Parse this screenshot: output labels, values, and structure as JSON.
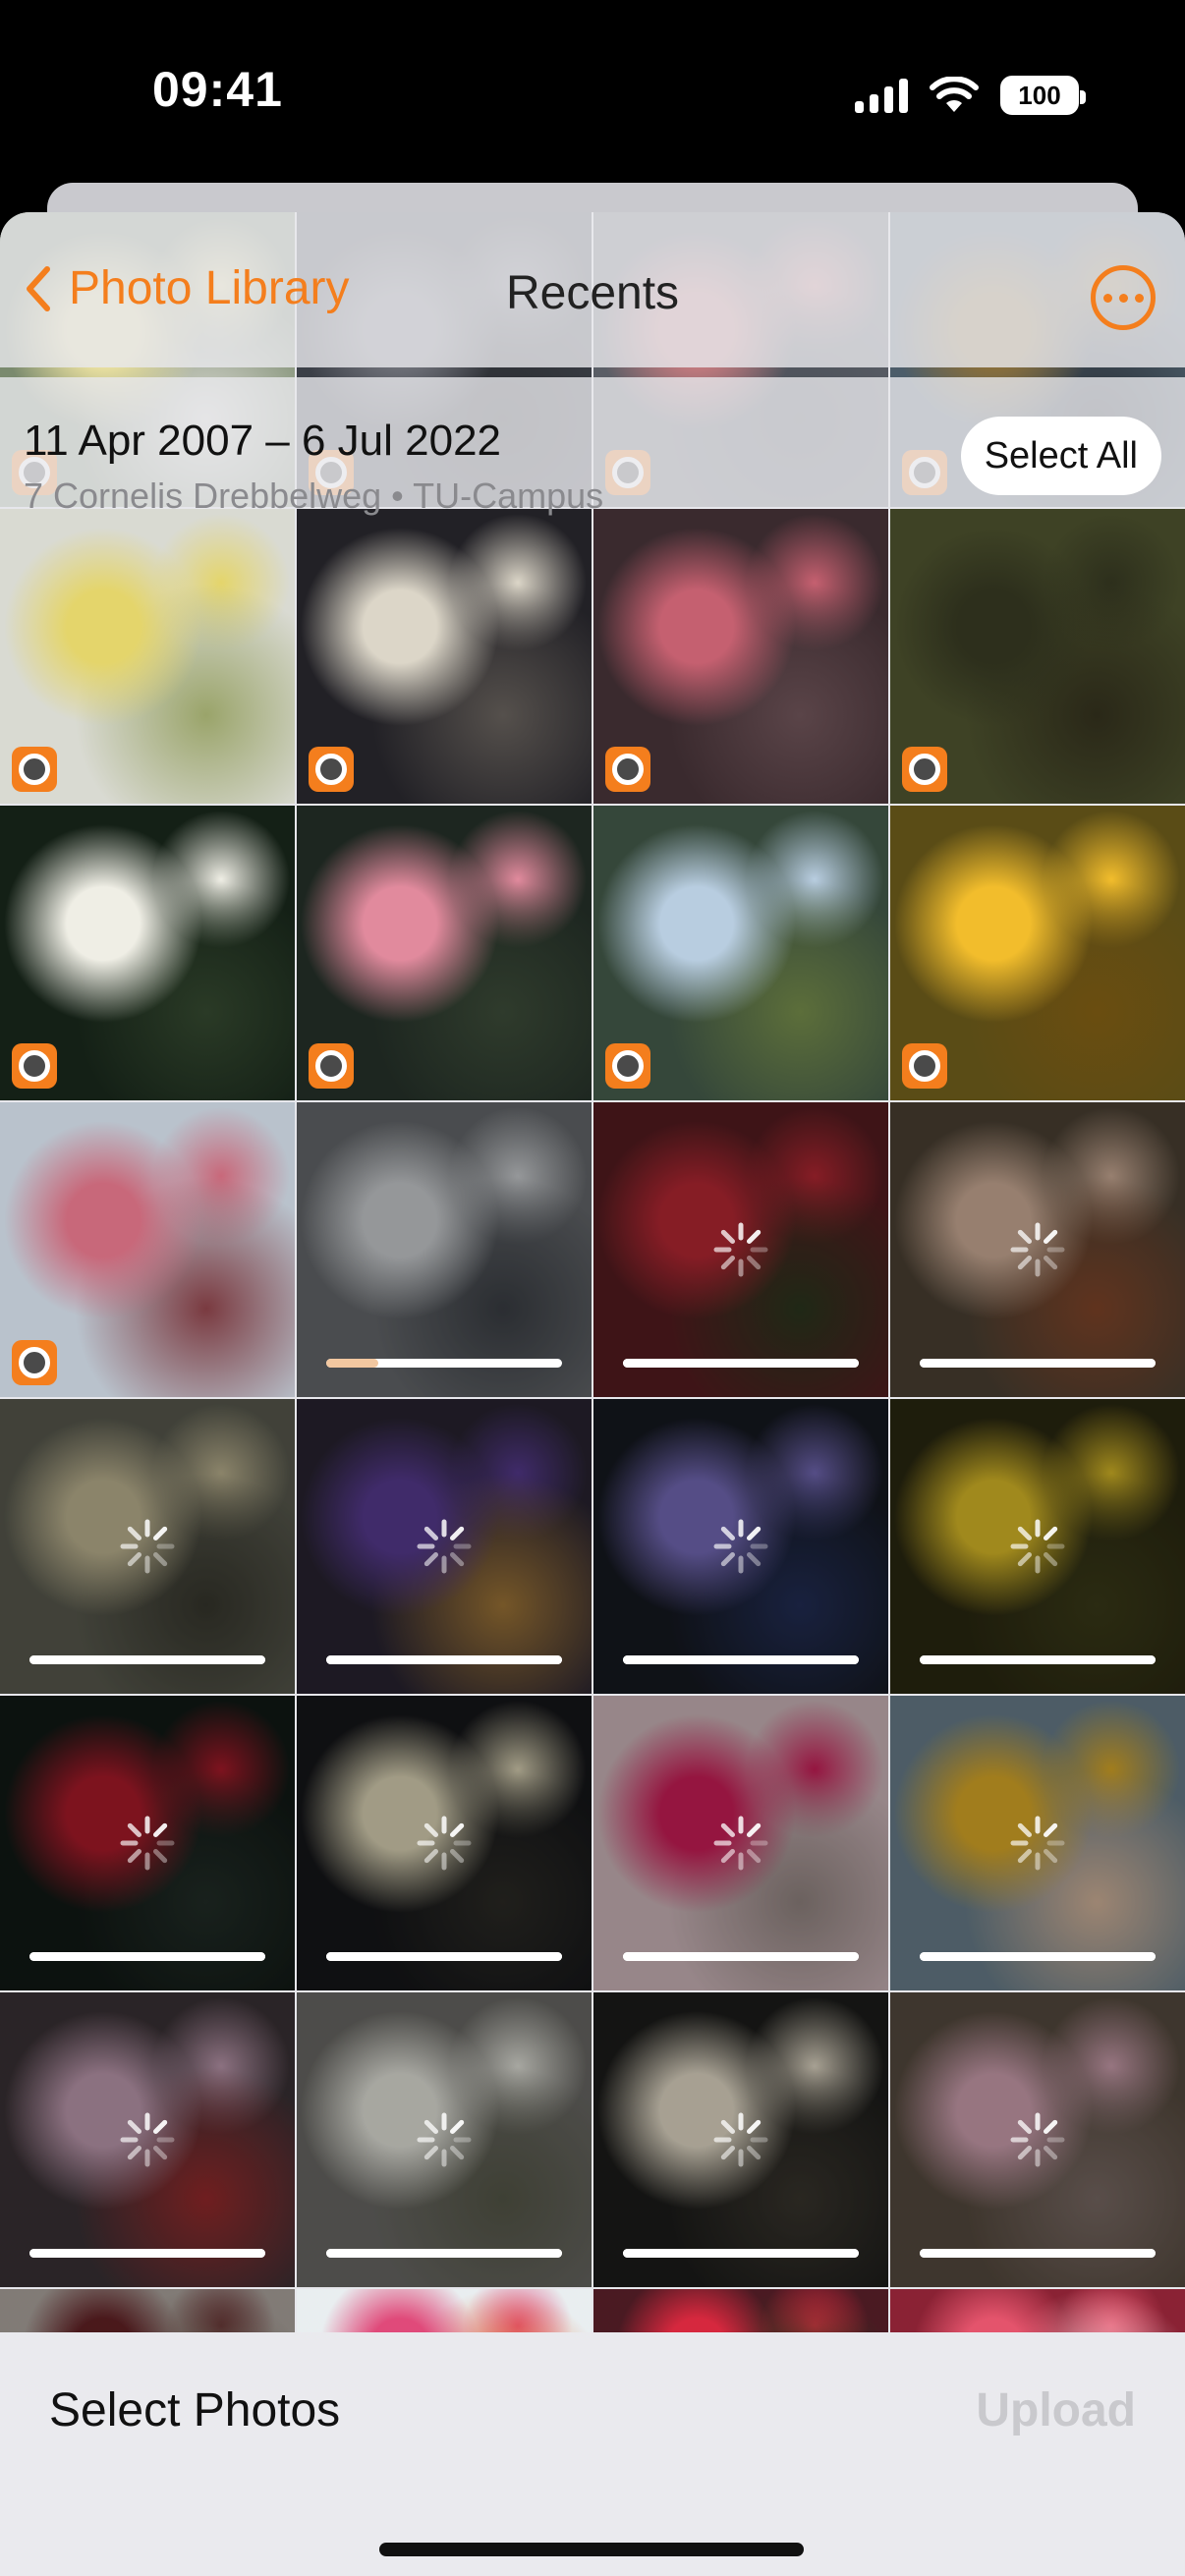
{
  "status_bar": {
    "time": "09:41",
    "battery": "100"
  },
  "nav": {
    "back_label": "Photo Library",
    "title": "Recents",
    "more_icon": "ellipsis-circle-icon"
  },
  "header": {
    "date_range": "11 Apr 2007 – 6 Jul 2022",
    "location": "7 Cornelis Drebbelweg • TU-Campus",
    "select_all": "Select All"
  },
  "toolbar": {
    "select_photos": "Select Photos",
    "upload": "Upload"
  },
  "colors": {
    "accent": "#f47e1d",
    "upload_disabled": "#c9c9cd"
  },
  "photos": [
    {
      "state": "badge",
      "bg": "#7a8a6e",
      "c1": "#e9e0a0",
      "c2": "#d7d7d0"
    },
    {
      "state": "badge",
      "bg": "#3b3f47",
      "c1": "#6e7078",
      "c2": "#2a2c30"
    },
    {
      "state": "badge",
      "bg": "#5a5e66",
      "c1": "#c27a7e",
      "c2": "#4a4f58"
    },
    {
      "state": "badge",
      "bg": "#4c5d6a",
      "c1": "#8a6f3a",
      "c2": "#2a3038"
    },
    {
      "state": "badge",
      "bg": "#d9dad2",
      "c1": "#e4d56b",
      "c2": "#9aa46a"
    },
    {
      "state": "badge",
      "bg": "#222126",
      "c1": "#dcd6c8",
      "c2": "#55504c"
    },
    {
      "state": "badge",
      "bg": "#3a2a2e",
      "c1": "#c56070",
      "c2": "#5a4448"
    },
    {
      "state": "badge",
      "bg": "#3e4225",
      "c1": "#2d2f1c",
      "c2": "#2a2818"
    },
    {
      "state": "badge",
      "bg": "#142016",
      "c1": "#efeee5",
      "c2": "#2a3a26"
    },
    {
      "state": "badge",
      "bg": "#1d2620",
      "c1": "#e18a9d",
      "c2": "#2f3b2c"
    },
    {
      "state": "badge",
      "bg": "#35473a",
      "c1": "#b8cde0",
      "c2": "#5c6e3a"
    },
    {
      "state": "badge",
      "bg": "#5a4c16",
      "c1": "#f2bd2c",
      "c2": "#6a4d10"
    },
    {
      "state": "badge",
      "bg": "#b9c2cc",
      "c1": "#c8687a",
      "c2": "#7a3a40"
    },
    {
      "state": "progress",
      "progress": 0.22,
      "bg": "#6b6e72",
      "c1": "#d6d9dc",
      "c2": "#3e4248"
    },
    {
      "state": "spinner",
      "progress": 1,
      "bg": "#5a1e22",
      "c1": "#c02a36",
      "c2": "#2e3a20"
    },
    {
      "state": "spinner",
      "progress": 1,
      "bg": "#4f4436",
      "c1": "#d9b7a0",
      "c2": "#8a4a2c"
    },
    {
      "state": "spinner",
      "progress": 1,
      "bg": "#5d5e52",
      "c1": "#c7bd98",
      "c2": "#3a3a30"
    },
    {
      "state": "spinner",
      "progress": 1,
      "bg": "#2a2533",
      "c1": "#5c3e98",
      "c2": "#a87c3a"
    },
    {
      "state": "spinner",
      "progress": 1,
      "bg": "#161a22",
      "c1": "#7a6fc0",
      "c2": "#24305a"
    },
    {
      "state": "spinner",
      "progress": 1,
      "bg": "#2c2a12",
      "c1": "#e5c42a",
      "c2": "#3e3e1a"
    },
    {
      "state": "spinner",
      "progress": 1,
      "bg": "#121a16",
      "c1": "#b41c2c",
      "c2": "#24302a"
    },
    {
      "state": "spinner",
      "progress": 1,
      "bg": "#16171a",
      "c1": "#e7dfbf",
      "c2": "#2e2d28"
    },
    {
      "state": "spinner",
      "progress": 1,
      "bg": "#d8c0c4",
      "c1": "#d61f5c",
      "c2": "#9a8c88"
    },
    {
      "state": "spinner",
      "progress": 1,
      "bg": "#6f8592",
      "c1": "#e7b32a",
      "c2": "#e0bfa4"
    },
    {
      "state": "spinner",
      "progress": 1,
      "bg": "#3d3438",
      "c1": "#c8a2b8",
      "c2": "#a02c2e"
    },
    {
      "state": "spinner",
      "progress": 1,
      "bg": "#6f6e6a",
      "c1": "#efefe6",
      "c2": "#5a5c4c"
    },
    {
      "state": "spinner",
      "progress": 1,
      "bg": "#1e1e1c",
      "c1": "#efe6d2",
      "c2": "#3c3830"
    },
    {
      "state": "spinner",
      "progress": 1,
      "bg": "#5a4e42",
      "c1": "#d8a8b8",
      "c2": "#80706a"
    },
    {
      "state": "spinner_short",
      "bg": "#b9b0a9",
      "c1": "#6a2428",
      "c2": "#8a7a6c"
    },
    {
      "state": "plain_short",
      "bg": "#e9eef0",
      "c1": "#e04a7a",
      "c2": "#e06a2a"
    },
    {
      "state": "plain_short",
      "bg": "#4a1a22",
      "c1": "#d6283e",
      "c2": "#2e3a1e"
    },
    {
      "state": "plain_short",
      "bg": "#8a2234",
      "c1": "#e4546c",
      "c2": "#f1c2ca"
    }
  ]
}
